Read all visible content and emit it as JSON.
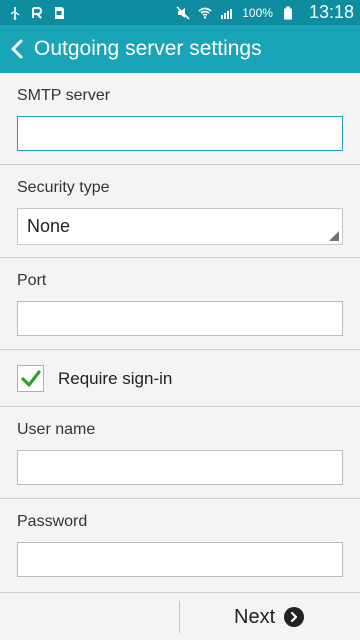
{
  "status_bar": {
    "battery_text": "100%",
    "time": "13:18"
  },
  "app_bar": {
    "title": "Outgoing server settings"
  },
  "form": {
    "smtp": {
      "label": "SMTP server",
      "value": ""
    },
    "security": {
      "label": "Security type",
      "selected": "None"
    },
    "port": {
      "label": "Port",
      "value": ""
    },
    "require_signin": {
      "label": "Require sign-in",
      "checked": true
    },
    "username": {
      "label": "User name",
      "value": ""
    },
    "password": {
      "label": "Password",
      "value": ""
    }
  },
  "bottom_bar": {
    "next_label": "Next"
  },
  "colors": {
    "statusbar": "#0f8ca0",
    "appbar": "#1aa4b8",
    "check": "#2aa52a"
  }
}
